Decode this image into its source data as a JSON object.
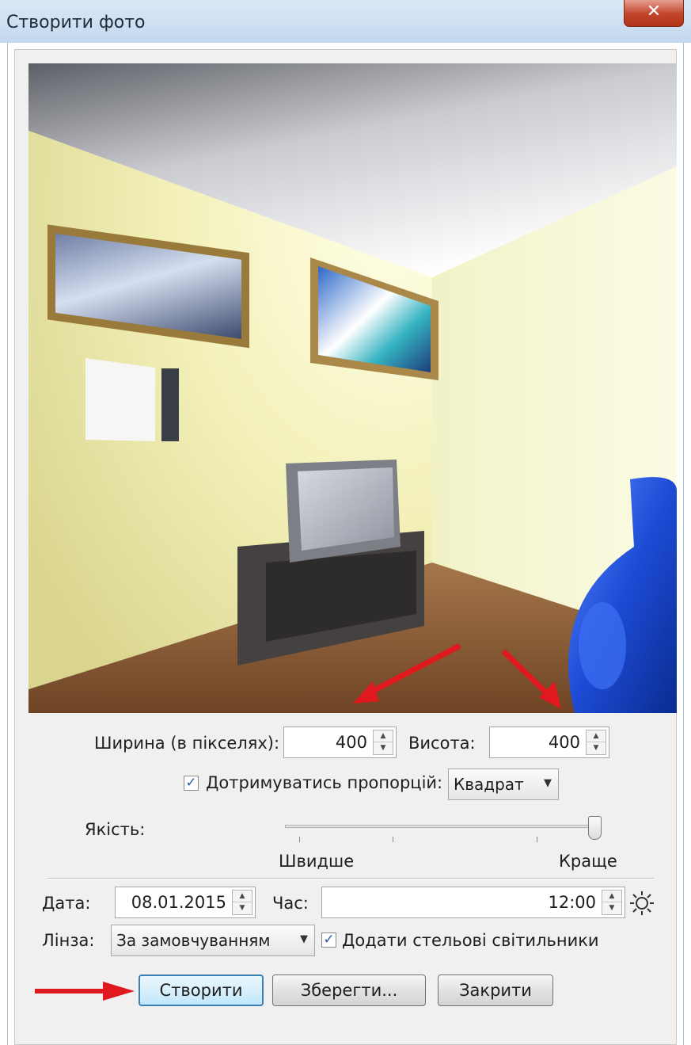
{
  "window": {
    "title": "Створити фото",
    "close_label": "✕"
  },
  "size": {
    "width_label": "Ширина (в пікселях):",
    "width_value": "400",
    "height_label": "Висота:",
    "height_value": "400"
  },
  "proportions": {
    "checked": true,
    "label": "Дотримуватись пропорцій:",
    "selected": "Квадрат"
  },
  "quality": {
    "label": "Якість:",
    "min_label": "Швидше",
    "max_label": "Краще",
    "level": 1.0
  },
  "date": {
    "label": "Дата:",
    "value": "08.01.2015"
  },
  "time": {
    "label": "Час:",
    "value": "12:00"
  },
  "lens": {
    "label": "Лінза:",
    "selected": "За замовчуванням"
  },
  "ceiling_lights": {
    "checked": true,
    "label": "Додати стельові світильники"
  },
  "buttons": {
    "create": "Створити",
    "save": "Зберегти...",
    "close": "Закрити"
  },
  "icons": {
    "daylight": "sun-icon",
    "close": "close-icon",
    "dropdown": "chevron-down-icon"
  },
  "colors": {
    "default_button_border": "#3c7fb1",
    "annotation_arrow": "#e0191e",
    "title_bar": "#c4d8ee"
  }
}
